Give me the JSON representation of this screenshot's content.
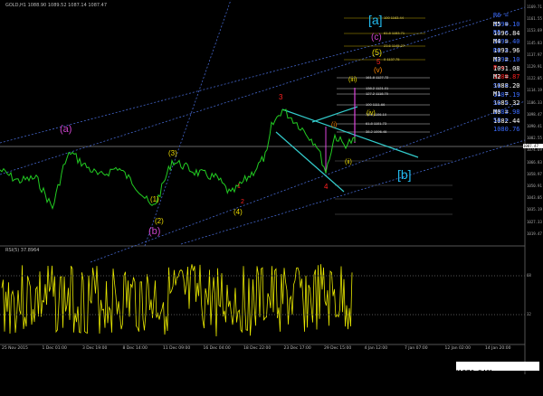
{
  "window": {
    "symbol_line": "GOLD,H1  1088.90 1089.52 1087.14 1087.47"
  },
  "price_axis": [
    "1169.71",
    "1161.55",
    "1153.69",
    "1145.83",
    "1137.97",
    "1129.91",
    "1122.05",
    "1114.19",
    "1106.33",
    "1098.47",
    "1090.41",
    "1082.55",
    "1074.69",
    "1066.83",
    "1058.97",
    "1050.91",
    "1043.05",
    "1035.19",
    "1027.33",
    "1019.47"
  ],
  "current_price_tag": "1087.47",
  "levels": [
    {
      "name": "R6",
      "value": "= 1099.10",
      "color": "#3b6cff"
    },
    {
      "name": "M5",
      "value": "= 1096.84",
      "color": "#ffffff"
    },
    {
      "name": "R5",
      "value": "= 1095.40",
      "color": "#3b6cff"
    },
    {
      "name": "M4",
      "value": "= 1093.96",
      "color": "#ffffff"
    },
    {
      "name": "R1",
      "value": "= 1092.10",
      "color": "#3b6cff"
    },
    {
      "name": "M3",
      "value": "= 1091.08",
      "color": "#ffffff"
    },
    {
      "name": "P",
      "value": "= 1089.87",
      "color": "#ff2020"
    },
    {
      "name": "M2",
      "value": "= 1088.20",
      "color": "#ffffff"
    },
    {
      "name": "S1",
      "value": "= 1087.19",
      "color": "#3b6cff"
    },
    {
      "name": "M1",
      "value": "= 1085.32",
      "color": "#ffffff"
    },
    {
      "name": "S2",
      "value": "= 1083.98",
      "color": "#3b6cff"
    },
    {
      "name": "M0",
      "value": "= 1082.44",
      "color": "#ffffff"
    },
    {
      "name": "S3",
      "value": "= 1080.76",
      "color": "#3b6cff"
    }
  ],
  "fib_labels": [
    "100  1163.44",
    "61.8  1153.71",
    "23.6  1145.27",
    "0  1137.75",
    "161.8  1127.72",
    "138.2  1121.01",
    "127.2  1118.70",
    "100  1111.66",
    "78.6  1106.10",
    "61.8  1101.73",
    "38.2  1096.46"
  ],
  "waves": {
    "a_big": "[a]",
    "c_small": "(c)",
    "five_y": "(5)",
    "five_r": "5",
    "v_orange": "(v)",
    "iii": "(iii)",
    "iv": "(iv)",
    "i": "(i)",
    "ii": "(ii)",
    "three": "3",
    "four": "4",
    "a_small": "(a)",
    "b_small": "(b)",
    "b_big": "[b]",
    "w1": "(1)",
    "w2": "(2)",
    "w3": "(3)",
    "w4": "(4)",
    "r1": "1",
    "r2": "2"
  },
  "rsi": {
    "title": "RSI(5) 37.8964",
    "level_hi": "68",
    "level_lo": "32"
  },
  "time_axis": [
    "25 Nov 2015",
    "1 Dec 01:00",
    "3 Dec 19:00",
    "8 Dec 14:00",
    "11 Dec 09:00",
    "16 Dec 04:00",
    "18 Dec 22:00",
    "23 Dec 17:00",
    "29 Dec 15:00",
    "4 Jan 12:00",
    "7 Jan 07:00",
    "12 Jan 02:00",
    "14 Jan 20:00"
  ],
  "footer": {
    "text": "[1276x840] http://upic.me/"
  }
}
